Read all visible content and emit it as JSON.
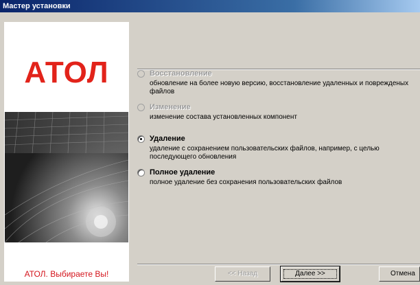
{
  "window": {
    "title": "Мастер установки"
  },
  "sidebar": {
    "logo_text": "АТОЛ",
    "slogan": "АТОЛ. Выбираете Вы!"
  },
  "options": [
    {
      "label": "Восстановление",
      "description": "обновление на более новую версию, восстановление удаленных и поврежденых файлов",
      "enabled": false,
      "selected": false
    },
    {
      "label": "Изменение",
      "description": "изменение состава установленных компонент",
      "enabled": false,
      "selected": false
    },
    {
      "label": "Удаление",
      "description": "удаление с сохранением пользовательских файлов, например, с целью последующего обновления",
      "enabled": true,
      "selected": true
    },
    {
      "label": "Полное удаление",
      "description": "полное удаление без сохранения пользовательских файлов",
      "enabled": true,
      "selected": false
    }
  ],
  "buttons": {
    "back": "<< Назад",
    "next": "Далее >>",
    "cancel": "Отмена"
  }
}
